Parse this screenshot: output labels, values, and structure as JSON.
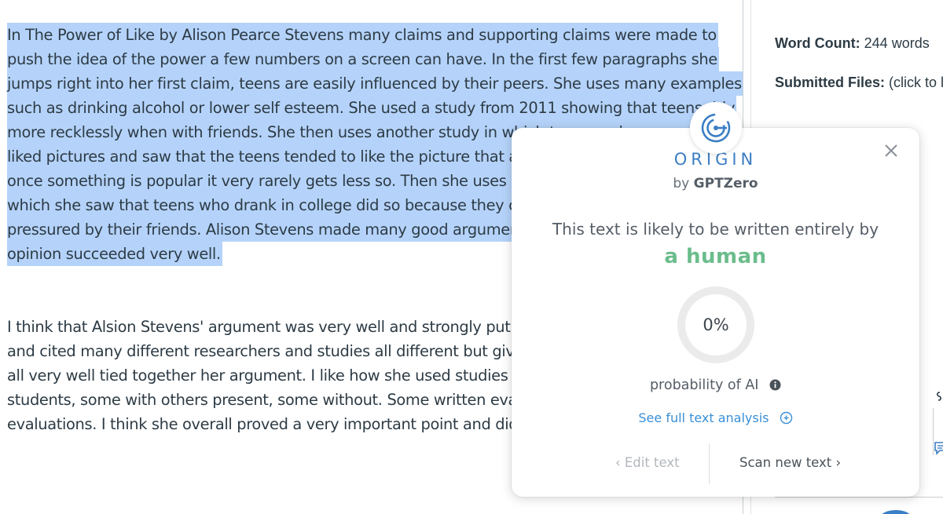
{
  "essay": {
    "paragraph1_lines": [
      "  In The Power of Like by Alison Pearce Stevens many claims and supporting claims were made to",
      "push the idea of the power a few numbers on a screen can have. In the first few paragraphs she",
      "jumps right into her first claim, teens are easily influenced by their peers. She uses many examples",
      "such as drinking alcohol or lower self esteem. She used a study from 2011 showing that teens driv",
      "more recklessly when with friends. She then uses another study in which teens and young adu",
      "liked pictures and saw that the teens tended to like the picture that alre",
      "once something is popular it very rarely gets less so. Then she uses a st",
      "which she saw that teens who drank in college did so because they con",
      "pressured by their friends. Alison Stevens made many good arguments t",
      "opinion succeeded very well."
    ],
    "paragraph2_lines": [
      "    I think that Alsion Stevens' argument was very well and strongly put",
      "and cited many different researchers and studies all different but giving",
      "all very well tied together her argument. I like how she used studies on",
      "students, some with others present, some without. Some written evalua",
      "evaluations. I think she overall proved a very important point and did so"
    ]
  },
  "side_panel": {
    "word_count_label": "Word Count:",
    "word_count_value": "244 words",
    "submitted_files_label": "Submitted Files:",
    "submitted_files_value": "(click to lo"
  },
  "popup": {
    "brand": "ORIGIN",
    "byline_prefix": "by",
    "byline_brand": "GPTZero",
    "verdict_line": "This text is likely to be written entirely by",
    "verdict_strong": "a human",
    "probability_value": "0%",
    "probability_fraction": 0,
    "probability_label": "probability of AI",
    "full_analysis_link": "See full text analysis",
    "edit_button": "‹ Edit text",
    "scan_button": "Scan new text ›",
    "colors": {
      "brand": "#3b7ec4",
      "human": "#6bbd8c",
      "link": "#3a8fd6",
      "gauge_track": "#ebebeb"
    }
  }
}
